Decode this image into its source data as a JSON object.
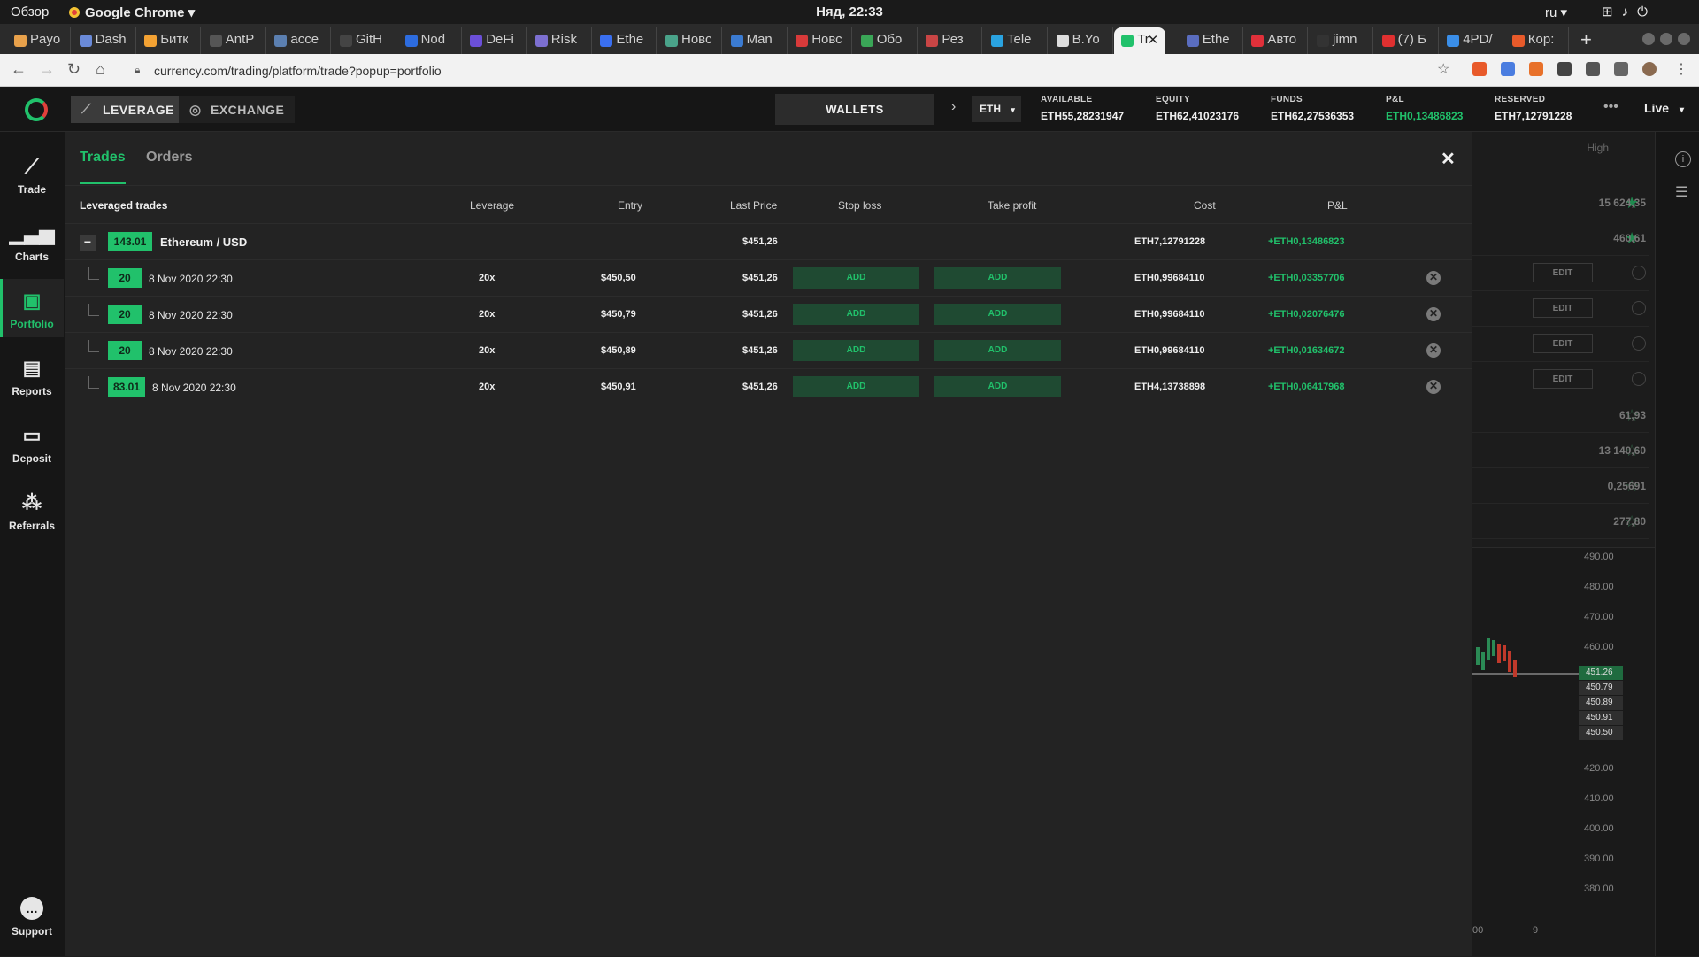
{
  "os": {
    "overview": "Обзор",
    "app_name": "Google Chrome ▾",
    "clock": "Няд, 22:33",
    "lang": "ru ▾"
  },
  "browser": {
    "tabs": [
      {
        "label": "Payo",
        "color": "#e8a14b"
      },
      {
        "label": "Dash",
        "color": "#6a8ad8"
      },
      {
        "label": "Битк",
        "color": "#f3a233"
      },
      {
        "label": "AntP",
        "color": "#555555"
      },
      {
        "label": "acce",
        "color": "#5b7fb0"
      },
      {
        "label": "GitH",
        "color": "#444444"
      },
      {
        "label": "Nod",
        "color": "#2d6cdf"
      },
      {
        "label": "DeFi",
        "color": "#6b4fd8"
      },
      {
        "label": "Risk",
        "color": "#7c6fd0"
      },
      {
        "label": "Ethe",
        "color": "#3a6ff0"
      },
      {
        "label": "Новс",
        "color": "#4aa38a"
      },
      {
        "label": "Man",
        "color": "#3b7bd1"
      },
      {
        "label": "Новс",
        "color": "#d83a3a"
      },
      {
        "label": "Обо",
        "color": "#3aa657"
      },
      {
        "label": "Рез",
        "color": "#c94545"
      },
      {
        "label": "Tele",
        "color": "#2aa3e0"
      },
      {
        "label": "B.Yo",
        "color": "#dddddd"
      },
      {
        "label": "Tr",
        "color": "#21c16b",
        "active": true
      },
      {
        "label": "Ethe",
        "color": "#5a6dbf"
      },
      {
        "label": "Авто",
        "color": "#e0303a"
      },
      {
        "label": "jimn",
        "color": "#333333"
      },
      {
        "label": "(7) Б",
        "color": "#e03030"
      },
      {
        "label": "4PD/",
        "color": "#3a8ee8"
      },
      {
        "label": "Кор:",
        "color": "#e85a2a"
      }
    ],
    "url": "currency.com/trading/platform/trade?popup=portfolio"
  },
  "header": {
    "leverage_label": "LEVERAGE",
    "exchange_label": "EXCHANGE",
    "wallets_label": "WALLETS",
    "currency": "ETH",
    "stats": [
      {
        "label": "AVAILABLE",
        "value": "ETH55,28231947",
        "green": false
      },
      {
        "label": "EQUITY",
        "value": "ETH62,41023176",
        "green": false
      },
      {
        "label": "FUNDS",
        "value": "ETH62,27536353",
        "green": false
      },
      {
        "label": "P&L",
        "value": "ETH0,13486823",
        "green": true
      },
      {
        "label": "RESERVED",
        "value": "ETH7,12791228",
        "green": false
      }
    ],
    "more": "•••",
    "live_label": "Live"
  },
  "sidebar": {
    "items": [
      {
        "label": "Trade",
        "icon": "trade-chart-icon"
      },
      {
        "label": "Charts",
        "icon": "charts-icon"
      },
      {
        "label": "Portfolio",
        "icon": "portfolio-icon",
        "active": true
      },
      {
        "label": "Reports",
        "icon": "reports-icon"
      },
      {
        "label": "Deposit",
        "icon": "deposit-icon"
      },
      {
        "label": "Referrals",
        "icon": "referrals-icon"
      }
    ],
    "support_label": "Support"
  },
  "portfolio": {
    "tabs": [
      "Trades",
      "Orders"
    ],
    "columns": {
      "name": "Leveraged trades",
      "leverage": "Leverage",
      "entry": "Entry",
      "last_price": "Last Price",
      "stop_loss": "Stop loss",
      "take_profit": "Take profit",
      "cost": "Cost",
      "pnl": "P&L"
    },
    "group": {
      "qty": "143.01",
      "name": "Ethereum / USD",
      "last_price": "$451,26",
      "cost": "ETH7,12791228",
      "pnl": "+ETH0,13486823"
    },
    "trades": [
      {
        "qty": "20",
        "date": "8 Nov 2020 22:30",
        "leverage": "20x",
        "entry": "$450,50",
        "last_price": "$451,26",
        "stop_loss": "ADD",
        "take_profit": "ADD",
        "cost": "ETH0,99684110",
        "pnl": "+ETH0,03357706"
      },
      {
        "qty": "20",
        "date": "8 Nov 2020 22:30",
        "leverage": "20x",
        "entry": "$450,79",
        "last_price": "$451,26",
        "stop_loss": "ADD",
        "take_profit": "ADD",
        "cost": "ETH0,99684110",
        "pnl": "+ETH0,02076476"
      },
      {
        "qty": "20",
        "date": "8 Nov 2020 22:30",
        "leverage": "20x",
        "entry": "$450,89",
        "last_price": "$451,26",
        "stop_loss": "ADD",
        "take_profit": "ADD",
        "cost": "ETH0,99684110",
        "pnl": "+ETH0,01634672"
      },
      {
        "qty": "83.01",
        "date": "8 Nov 2020 22:30",
        "leverage": "20x",
        "entry": "$450,91",
        "last_price": "$451,26",
        "stop_loss": "ADD",
        "take_profit": "ADD",
        "cost": "ETH4,13738898",
        "pnl": "+ETH0,06417968"
      }
    ]
  },
  "background_panel": {
    "header": "High",
    "rows": [
      {
        "value": "15 624,35",
        "star": true
      },
      {
        "value": "460,61",
        "star": true
      },
      {
        "edit": "EDIT"
      },
      {
        "edit": "EDIT"
      },
      {
        "edit": "EDIT"
      },
      {
        "edit": "EDIT"
      },
      {
        "value": "61,93",
        "star": false
      },
      {
        "value": "13 140,60",
        "star": false
      },
      {
        "value": "0,25691",
        "star": false
      },
      {
        "value": "277,80",
        "star": false
      }
    ],
    "price_axis": [
      "490.00",
      "480.00",
      "470.00",
      "460.00",
      "420.00",
      "410.00",
      "400.00",
      "390.00",
      "380.00"
    ],
    "price_tags": [
      {
        "label": "451.26",
        "color": "#1f6b3f"
      },
      {
        "label": "450.79",
        "color": "#2f2f2f"
      },
      {
        "label": "450.89",
        "color": "#2f2f2f"
      },
      {
        "label": "450.91",
        "color": "#2f2f2f"
      },
      {
        "label": "450.50",
        "color": "#2f2f2f"
      }
    ],
    "time_axis": [
      "00",
      "9"
    ]
  },
  "colors": {
    "accent": "#21c16b",
    "background": "#232323",
    "sidebar": "#161616"
  }
}
